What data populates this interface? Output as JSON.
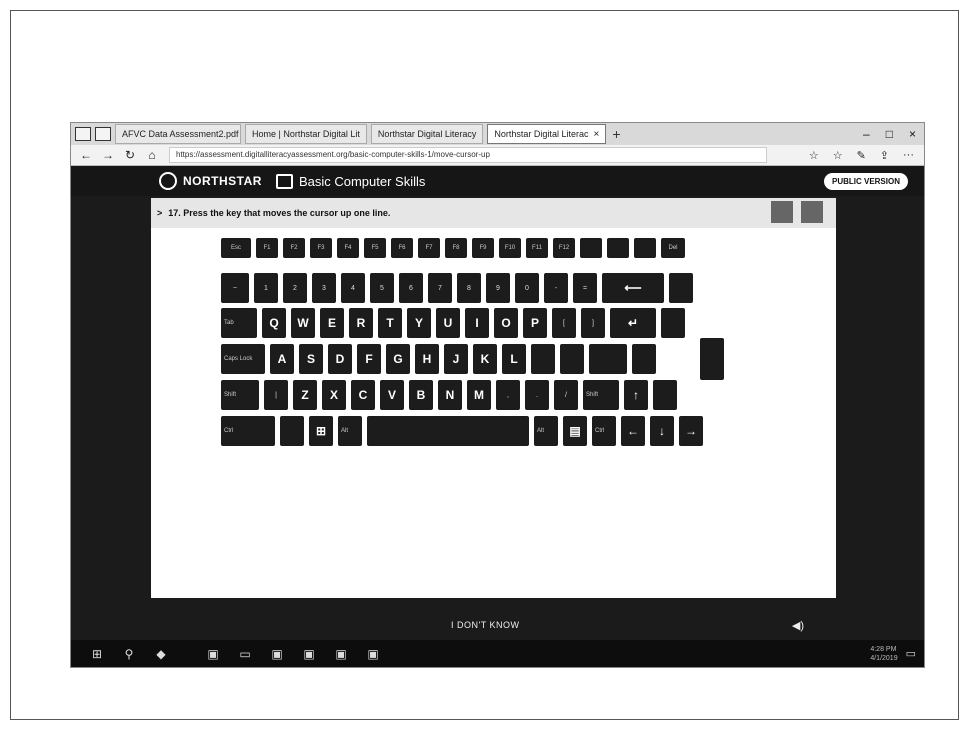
{
  "browser": {
    "tabs": [
      {
        "label": "AFVC Data Assessment2.pdf",
        "active": false
      },
      {
        "label": "Home | Northstar Digital Lit",
        "active": false
      },
      {
        "label": "Northstar Digital Literacy",
        "active": false
      },
      {
        "label": "Northstar Digital Literac",
        "active": true
      }
    ],
    "close_glyph": "×",
    "new_tab_glyph": "+",
    "window_controls": [
      "–",
      "□",
      "×"
    ],
    "nav": {
      "back": "←",
      "forward": "→",
      "refresh": "↻",
      "home": "⌂"
    },
    "url": "https://assessment.digitalliteracyassessment.org/basic-computer-skills-1/move-cursor-up",
    "right_tools": [
      "☆",
      "☆",
      "✎",
      "⇪",
      "···"
    ]
  },
  "site": {
    "brand": "NORTHSTAR",
    "course": "Basic Computer Skills",
    "public_version": "PUBLIC VERSION"
  },
  "question": {
    "chevron": ">",
    "text": "17. Press the key that moves the cursor up one line."
  },
  "keyboard": {
    "rows": [
      [
        {
          "label": "Esc",
          "w": 30,
          "t": "fn"
        },
        {
          "label": "F1",
          "w": 22,
          "t": "fn"
        },
        {
          "label": "F2",
          "w": 22,
          "t": "fn"
        },
        {
          "label": "F3",
          "w": 22,
          "t": "fn"
        },
        {
          "label": "F4",
          "w": 22,
          "t": "fn"
        },
        {
          "label": "F5",
          "w": 22,
          "t": "fn"
        },
        {
          "label": "F6",
          "w": 22,
          "t": "fn"
        },
        {
          "label": "F7",
          "w": 22,
          "t": "fn"
        },
        {
          "label": "F8",
          "w": 22,
          "t": "fn"
        },
        {
          "label": "F9",
          "w": 22,
          "t": "fn"
        },
        {
          "label": "F10",
          "w": 22,
          "t": "fn"
        },
        {
          "label": "F11",
          "w": 22,
          "t": "fn"
        },
        {
          "label": "F12",
          "w": 22,
          "t": "fn"
        },
        {
          "label": "",
          "w": 22,
          "t": "fn"
        },
        {
          "label": "",
          "w": 22,
          "t": "fn"
        },
        {
          "label": "",
          "w": 22,
          "t": "fn"
        },
        {
          "label": "Del",
          "w": 24,
          "t": "fn"
        }
      ],
      [
        {
          "label": "~",
          "w": 28,
          "t": "small"
        },
        {
          "label": "1",
          "w": 24,
          "t": "small"
        },
        {
          "label": "2",
          "w": 24,
          "t": "small"
        },
        {
          "label": "3",
          "w": 24,
          "t": "small"
        },
        {
          "label": "4",
          "w": 24,
          "t": "small"
        },
        {
          "label": "5",
          "w": 24,
          "t": "small"
        },
        {
          "label": "6",
          "w": 24,
          "t": "small"
        },
        {
          "label": "7",
          "w": 24,
          "t": "small"
        },
        {
          "label": "8",
          "w": 24,
          "t": "small"
        },
        {
          "label": "9",
          "w": 24,
          "t": "small"
        },
        {
          "label": "0",
          "w": 24,
          "t": "small"
        },
        {
          "label": "-",
          "w": 24,
          "t": "small"
        },
        {
          "label": "=",
          "w": 24,
          "t": "small"
        },
        {
          "label": "⟵",
          "w": 62,
          "t": "normal"
        },
        {
          "label": "",
          "w": 24,
          "t": "fn"
        }
      ],
      [
        {
          "label": "Tab",
          "w": 36,
          "t": "mod"
        },
        {
          "label": "Q",
          "w": 24,
          "t": "normal"
        },
        {
          "label": "W",
          "w": 24,
          "t": "normal"
        },
        {
          "label": "E",
          "w": 24,
          "t": "normal"
        },
        {
          "label": "R",
          "w": 24,
          "t": "normal"
        },
        {
          "label": "T",
          "w": 24,
          "t": "normal"
        },
        {
          "label": "Y",
          "w": 24,
          "t": "normal"
        },
        {
          "label": "U",
          "w": 24,
          "t": "normal"
        },
        {
          "label": "I",
          "w": 24,
          "t": "normal"
        },
        {
          "label": "O",
          "w": 24,
          "t": "normal"
        },
        {
          "label": "P",
          "w": 24,
          "t": "normal"
        },
        {
          "label": "[",
          "w": 24,
          "t": "small"
        },
        {
          "label": "]",
          "w": 24,
          "t": "small"
        },
        {
          "label": "↵",
          "w": 46,
          "t": "normal"
        },
        {
          "label": "",
          "w": 24,
          "t": "fn"
        }
      ],
      [
        {
          "label": "Caps Lock",
          "w": 44,
          "t": "mod"
        },
        {
          "label": "A",
          "w": 24,
          "t": "normal"
        },
        {
          "label": "S",
          "w": 24,
          "t": "normal"
        },
        {
          "label": "D",
          "w": 24,
          "t": "normal"
        },
        {
          "label": "F",
          "w": 24,
          "t": "normal"
        },
        {
          "label": "G",
          "w": 24,
          "t": "normal"
        },
        {
          "label": "H",
          "w": 24,
          "t": "normal"
        },
        {
          "label": "J",
          "w": 24,
          "t": "normal"
        },
        {
          "label": "K",
          "w": 24,
          "t": "normal"
        },
        {
          "label": "L",
          "w": 24,
          "t": "normal"
        },
        {
          "label": "",
          "w": 24,
          "t": "small"
        },
        {
          "label": "",
          "w": 24,
          "t": "small"
        },
        {
          "label": "",
          "w": 38,
          "t": "small"
        },
        {
          "label": "",
          "w": 24,
          "t": "fn"
        }
      ],
      [
        {
          "label": "Shift",
          "w": 38,
          "t": "mod"
        },
        {
          "label": "|",
          "w": 24,
          "t": "small"
        },
        {
          "label": "Z",
          "w": 24,
          "t": "normal"
        },
        {
          "label": "X",
          "w": 24,
          "t": "normal"
        },
        {
          "label": "C",
          "w": 24,
          "t": "normal"
        },
        {
          "label": "V",
          "w": 24,
          "t": "normal"
        },
        {
          "label": "B",
          "w": 24,
          "t": "normal"
        },
        {
          "label": "N",
          "w": 24,
          "t": "normal"
        },
        {
          "label": "M",
          "w": 24,
          "t": "normal"
        },
        {
          "label": ",",
          "w": 24,
          "t": "small"
        },
        {
          "label": ".",
          "w": 24,
          "t": "small"
        },
        {
          "label": "/",
          "w": 24,
          "t": "small"
        },
        {
          "label": "Shift",
          "w": 36,
          "t": "mod"
        },
        {
          "label": "↑",
          "w": 24,
          "t": "normal"
        },
        {
          "label": "",
          "w": 24,
          "t": "fn"
        }
      ],
      [
        {
          "label": "Ctrl",
          "w": 54,
          "t": "mod"
        },
        {
          "label": "",
          "w": 24,
          "t": "fn"
        },
        {
          "label": "⊞",
          "w": 24,
          "t": "normal"
        },
        {
          "label": "Alt",
          "w": 24,
          "t": "mod"
        },
        {
          "label": "",
          "w": 162,
          "t": "fn"
        },
        {
          "label": "Alt",
          "w": 24,
          "t": "mod"
        },
        {
          "label": "▤",
          "w": 24,
          "t": "normal"
        },
        {
          "label": "Ctrl",
          "w": 24,
          "t": "mod"
        },
        {
          "label": "←",
          "w": 24,
          "t": "normal"
        },
        {
          "label": "↓",
          "w": 24,
          "t": "normal"
        },
        {
          "label": "→",
          "w": 24,
          "t": "normal"
        }
      ]
    ]
  },
  "footer": {
    "dont_know": "I DON'T KNOW",
    "speaker": "◀)"
  },
  "taskbar": {
    "icons": [
      "⊞",
      "⚲",
      "◆",
      "▣",
      "▭",
      "▣",
      "▣",
      "▣",
      "▣"
    ],
    "tray_time": "4:28 PM",
    "tray_date": "4/1/2019"
  }
}
